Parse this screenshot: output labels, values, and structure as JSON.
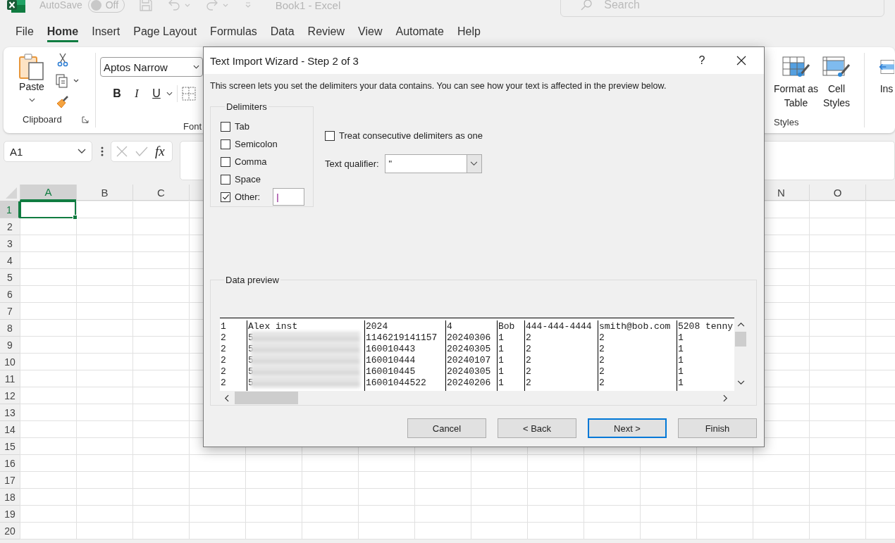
{
  "title_bar": {
    "autosave_label": "AutoSave",
    "autosave_toggle": {
      "label": "Off",
      "on": false
    },
    "document_title": "Book1  -  Excel",
    "search": {
      "placeholder": "Search"
    }
  },
  "ribbon_tabs": [
    {
      "label": "File",
      "selected": false
    },
    {
      "label": "Home",
      "selected": true
    },
    {
      "label": "Insert",
      "selected": false
    },
    {
      "label": "Page Layout",
      "selected": false
    },
    {
      "label": "Formulas",
      "selected": false
    },
    {
      "label": "Data",
      "selected": false
    },
    {
      "label": "Review",
      "selected": false
    },
    {
      "label": "View",
      "selected": false
    },
    {
      "label": "Automate",
      "selected": false
    },
    {
      "label": "Help",
      "selected": false
    }
  ],
  "ribbon": {
    "paste_label": "Paste",
    "clipboard_label": "Clipboard",
    "font_name": "Aptos Narrow",
    "bold": "B",
    "italic": "I",
    "underline": "U",
    "font_label": "Font",
    "format_as_table": "Format as\nTable",
    "cell_styles": "Cell\nStyles",
    "styles_label": "Styles",
    "insert_partial": "Ins"
  },
  "formula_bar": {
    "name_box": "A1",
    "fx": "fx"
  },
  "sheet": {
    "left_columns": [
      {
        "label": "A",
        "selected": true
      },
      {
        "label": "B",
        "selected": false
      },
      {
        "label": "C",
        "selected": false
      }
    ],
    "right_columns": [
      {
        "label": "N",
        "selected": false
      },
      {
        "label": "O",
        "selected": false
      }
    ],
    "rows": [
      {
        "label": "1",
        "selected": true
      },
      {
        "label": "2",
        "selected": false
      },
      {
        "label": "3",
        "selected": false
      },
      {
        "label": "4",
        "selected": false
      },
      {
        "label": "5",
        "selected": false
      },
      {
        "label": "6",
        "selected": false
      },
      {
        "label": "7",
        "selected": false
      },
      {
        "label": "8",
        "selected": false
      },
      {
        "label": "9",
        "selected": false
      },
      {
        "label": "10",
        "selected": false
      },
      {
        "label": "11",
        "selected": false
      },
      {
        "label": "12",
        "selected": false
      },
      {
        "label": "13",
        "selected": false
      },
      {
        "label": "14",
        "selected": false
      },
      {
        "label": "15",
        "selected": false
      },
      {
        "label": "16",
        "selected": false
      },
      {
        "label": "17",
        "selected": false
      },
      {
        "label": "18",
        "selected": false
      },
      {
        "label": "19",
        "selected": false
      },
      {
        "label": "20",
        "selected": false
      }
    ]
  },
  "dialog": {
    "title": "Text Import Wizard - Step 2 of 3",
    "help": "?",
    "description": "This screen lets you set the delimiters your data contains.  You can see how your text is affected in the preview below.",
    "delimiters_label": "Delimiters",
    "delimiters": [
      {
        "label": "Tab",
        "checked": false
      },
      {
        "label": "Semicolon",
        "checked": false
      },
      {
        "label": "Comma",
        "checked": false
      },
      {
        "label": "Space",
        "checked": false
      },
      {
        "label": "Other:",
        "checked": true,
        "value": "|"
      }
    ],
    "treat_consecutive": {
      "label": "Treat consecutive delimiters as one",
      "checked": false
    },
    "text_qualifier": {
      "label": "Text qualifier:",
      "value": "\""
    },
    "preview": {
      "label": "Data preview",
      "rows": [
        {
          "cells": [
            "1",
            "Alex inst",
            "2024",
            "4",
            "Bob",
            "444-444-4444",
            "smith@bob.com",
            "5208 tenny"
          ],
          "redacted": false
        },
        {
          "cells": [
            "2",
            "5",
            "1146219141157",
            "20240306",
            "1",
            "2",
            "2",
            "1"
          ],
          "redacted": true
        },
        {
          "cells": [
            "2",
            "5",
            "160010443",
            "20240305",
            "1",
            "2",
            "2",
            "1"
          ],
          "redacted": true
        },
        {
          "cells": [
            "2",
            "5",
            "160010444",
            "20240107",
            "1",
            "2",
            "2",
            "1"
          ],
          "redacted": true
        },
        {
          "cells": [
            "2",
            "5",
            "160010445",
            "20240305",
            "1",
            "2",
            "2",
            "1"
          ],
          "redacted": true
        },
        {
          "cells": [
            "2",
            "5",
            "16001044522",
            "20240206",
            "1",
            "2",
            "2",
            "1"
          ],
          "redacted": true
        }
      ]
    },
    "buttons": [
      {
        "label": "Cancel",
        "default": false
      },
      {
        "label": "< Back",
        "default": false
      },
      {
        "label": "Next >",
        "default": true
      },
      {
        "label": "Finish",
        "default": false
      }
    ]
  }
}
